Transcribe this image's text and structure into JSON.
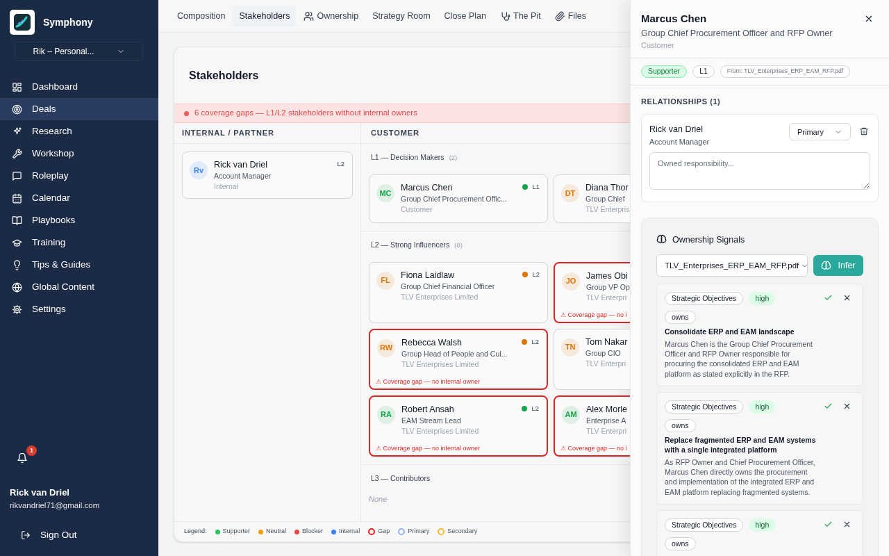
{
  "sidebar": {
    "brand": "Symphony",
    "workspace": "Rik – Personal...",
    "items": [
      {
        "label": "Dashboard",
        "selected": false
      },
      {
        "label": "Deals",
        "selected": true
      },
      {
        "label": "Research",
        "selected": false
      },
      {
        "label": "Workshop",
        "selected": false
      },
      {
        "label": "Roleplay",
        "selected": false
      },
      {
        "label": "Calendar",
        "selected": false
      },
      {
        "label": "Playbooks",
        "selected": false
      },
      {
        "label": "Training",
        "selected": false
      },
      {
        "label": "Tips & Guides",
        "selected": false
      },
      {
        "label": "Global Content",
        "selected": false
      },
      {
        "label": "Settings",
        "selected": false
      }
    ],
    "notification_count": "1",
    "user": {
      "name": "Rick van Driel",
      "email": "rikvandriel71@gmail.com"
    },
    "sign_out": "Sign Out"
  },
  "tabs": [
    {
      "label": "Composition",
      "selected": false
    },
    {
      "label": "Stakeholders",
      "selected": true
    },
    {
      "label": "Ownership",
      "selected": false
    },
    {
      "label": "Strategy Room",
      "selected": false
    },
    {
      "label": "Close Plan",
      "selected": false
    },
    {
      "label": "The Pit",
      "selected": false
    },
    {
      "label": "Files",
      "selected": false
    }
  ],
  "stakeholders": {
    "title": "Stakeholders",
    "alert": "6 coverage gaps — L1/L2 stakeholders without internal owners",
    "columns": [
      "INTERNAL / PARTNER",
      "CUSTOMER"
    ],
    "internal": [
      {
        "initials": "Rv",
        "name": "Rick van Driel",
        "title": "Account Manager",
        "org": "Internal",
        "level": "L2",
        "color": "#3b82f6",
        "dot": false,
        "gap": false
      }
    ],
    "groups": [
      {
        "label": "L1 — Decision Makers",
        "count": "(2)",
        "cards": [
          {
            "initials": "MC",
            "name": "Marcus Chen",
            "title": "Group Chief Procurement Offic...",
            "org": "Customer",
            "level": "L1",
            "color": "#16a34a",
            "dot": true,
            "gap": false
          },
          {
            "initials": "DT",
            "name": "Diana Thor",
            "title": "Group Chief",
            "org": "TLV Enterpris",
            "color": "#d97706",
            "gap": false
          }
        ]
      },
      {
        "label": "L2 — Strong Influencers",
        "count": "(8)",
        "cards": [
          {
            "initials": "FL",
            "name": "Fiona Laidlaw",
            "title": "Group Chief Financial Officer",
            "org": "TLV Enterprises Limited",
            "level": "L2",
            "color": "#d97706",
            "dot": true,
            "gap": false
          },
          {
            "initials": "JO",
            "name": "James Obi",
            "title": "Group VP Op",
            "org": "TLV Enterpri",
            "color": "#d97706",
            "gap": true,
            "gap_note": "⚠ Coverage gap — no i"
          },
          {
            "initials": "RW",
            "name": "Rebecca Walsh",
            "title": "Group Head of People and Cul...",
            "org": "TLV Enterprises Limited",
            "level": "L2",
            "color": "#d97706",
            "dot": true,
            "gap": true,
            "gap_note": "⚠ Coverage gap — no internal owner"
          },
          {
            "initials": "TN",
            "name": "Tom Nakar",
            "title": "Group CIO",
            "org": "TLV Enterpri",
            "color": "#d97706",
            "gap": false
          },
          {
            "initials": "RA",
            "name": "Robert Ansah",
            "title": "EAM Stream Lead",
            "org": "TLV Enterprises Limited",
            "level": "L2",
            "color": "#16a34a",
            "dot": true,
            "gap": true,
            "gap_note": "⚠ Coverage gap — no internal owner"
          },
          {
            "initials": "AM",
            "name": "Alex Morle",
            "title": "Enterprise A",
            "org": "TLV Enterpri",
            "color": "#16a34a",
            "gap": true,
            "gap_note": "⚠ Coverage gap — no i"
          }
        ]
      },
      {
        "label": "L3 — Contributors",
        "empty": "None"
      }
    ],
    "legend": {
      "label": "Legend:",
      "items": [
        {
          "label": "Supporter",
          "kind": "dot",
          "color": "#22c55e"
        },
        {
          "label": "Neutral",
          "kind": "dot",
          "color": "#f59e0b"
        },
        {
          "label": "Blocker",
          "kind": "dot",
          "color": "#ef4444"
        },
        {
          "label": "Internal",
          "kind": "dot",
          "color": "#3b82f6"
        },
        {
          "label": "Gap",
          "kind": "ring",
          "color": "#dc2626"
        },
        {
          "label": "Primary",
          "kind": "ring",
          "color": "#93b4f0"
        },
        {
          "label": "Secondary",
          "kind": "ring",
          "color": "#f5b82e"
        }
      ]
    }
  },
  "panel": {
    "name": "Marcus Chen",
    "title": "Group Chief Procurement Officer and RFP Owner",
    "subtitle": "Customer",
    "badges": [
      {
        "label": "Supporter",
        "kind": "stance"
      },
      {
        "label": "L1",
        "kind": "level"
      },
      {
        "label": "From: TLV_Enterprises_ERP_EAM_RFP.pdf",
        "kind": "source"
      }
    ],
    "relationships": {
      "heading": "RELATIONSHIPS (1)",
      "items": [
        {
          "name": "Rick van Driel",
          "role": "Account Manager",
          "type": "Primary",
          "placeholder": "Owned responsibility..."
        }
      ]
    },
    "signals": {
      "title": "Ownership Signals",
      "file": "TLV_Enterprises_ERP_EAM_RFP.pdf",
      "action": "Infer",
      "items": [
        {
          "category": "Strategic Objectives",
          "confidence": "high",
          "relation": "owns",
          "headline": "Consolidate ERP and EAM landscape",
          "detail": "Marcus Chen is the Group Chief Procurement Officer and RFP Owner responsible for procuring the consolidated ERP and EAM platform as stated explicitly in the RFP."
        },
        {
          "category": "Strategic Objectives",
          "confidence": "high",
          "relation": "owns",
          "headline": "Replace fragmented ERP and EAM systems with a single integrated platform",
          "detail": "As RFP Owner and Chief Procurement Officer, Marcus Chen directly owns the procurement and implementation of the integrated ERP and EAM platform replacing fragmented systems."
        },
        {
          "category": "Strategic Objectives",
          "confidence": "high",
          "relation": "owns"
        }
      ]
    }
  }
}
